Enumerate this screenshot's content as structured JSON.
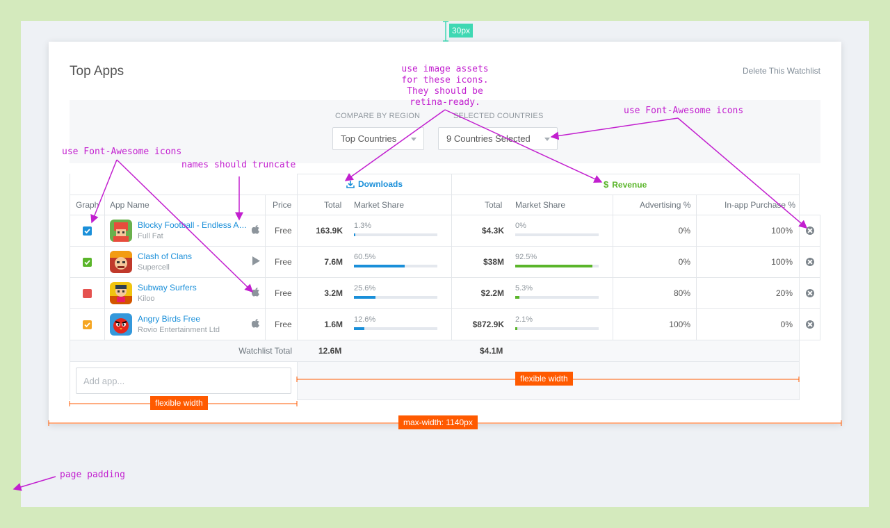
{
  "page": {
    "title": "Top Apps",
    "delete_link": "Delete This Watchlist"
  },
  "filters": {
    "region_label": "COMPARE BY REGION",
    "region_value": "Top Countries",
    "countries_label": "SELECTED COUNTRIES",
    "countries_value": "9 Countries Selected"
  },
  "table": {
    "group_headers": {
      "downloads": "Downloads",
      "revenue": "Revenue"
    },
    "columns": {
      "graph": "Graph",
      "app_name": "App Name",
      "price": "Price",
      "dl_total": "Total",
      "dl_share": "Market Share",
      "rev_total": "Total",
      "rev_share": "Market Share",
      "advertising": "Advertising %",
      "iap": "In-app Purchase %"
    },
    "rows": [
      {
        "name": "Blocky Football - Endless Arcade Runner",
        "developer": "Full Fat",
        "platform": "apple-icon",
        "price": "Free",
        "dl_total": "163.9K",
        "dl_share_label": "1.3%",
        "dl_share": 1.3,
        "rev_total": "$4.3K",
        "rev_share_label": "0%",
        "rev_share": 0,
        "advertising": "0%",
        "iap": "100%",
        "graph_color": "#1a8fd9",
        "graph_checked": true
      },
      {
        "name": "Clash of Clans",
        "developer": "Supercell",
        "platform": "play-icon",
        "price": "Free",
        "dl_total": "7.6M",
        "dl_share_label": "60.5%",
        "dl_share": 60.5,
        "rev_total": "$38M",
        "rev_share_label": "92.5%",
        "rev_share": 92.5,
        "advertising": "0%",
        "iap": "100%",
        "graph_color": "#5ab52a",
        "graph_checked": true
      },
      {
        "name": "Subway Surfers",
        "developer": "Kiloo",
        "platform": "apple-icon",
        "price": "Free",
        "dl_total": "3.2M",
        "dl_share_label": "25.6%",
        "dl_share": 25.6,
        "rev_total": "$2.2M",
        "rev_share_label": "5.3%",
        "rev_share": 5.3,
        "advertising": "80%",
        "iap": "20%",
        "graph_color": "#e5524f",
        "graph_checked": false
      },
      {
        "name": "Angry Birds Free",
        "developer": "Rovio Entertainment Ltd",
        "platform": "apple-icon",
        "price": "Free",
        "dl_total": "1.6M",
        "dl_share_label": "12.6%",
        "dl_share": 12.6,
        "rev_total": "$872.9K",
        "rev_share_label": "2.1%",
        "rev_share": 2.1,
        "advertising": "100%",
        "iap": "0%",
        "graph_color": "#f5a623",
        "graph_checked": true
      }
    ],
    "totals": {
      "label": "Watchlist Total",
      "downloads": "12.6M",
      "revenue": "$4.1M"
    },
    "add_placeholder": "Add app..."
  },
  "colors": {
    "downloads": "#1a8fd9",
    "revenue": "#5ab52a"
  },
  "annotations": {
    "spacing": "30px",
    "assets": [
      "use image assets",
      "for these icons.",
      "They should be",
      "retina-ready."
    ],
    "fa_top": "use Font-Awesome icons",
    "fa_left": "use Font-Awesome icons",
    "truncate": "names should truncate",
    "padding": "page padding",
    "flex1": "flexible width",
    "flex2": "flexible width",
    "maxwidth": "max-width: 1140px"
  }
}
